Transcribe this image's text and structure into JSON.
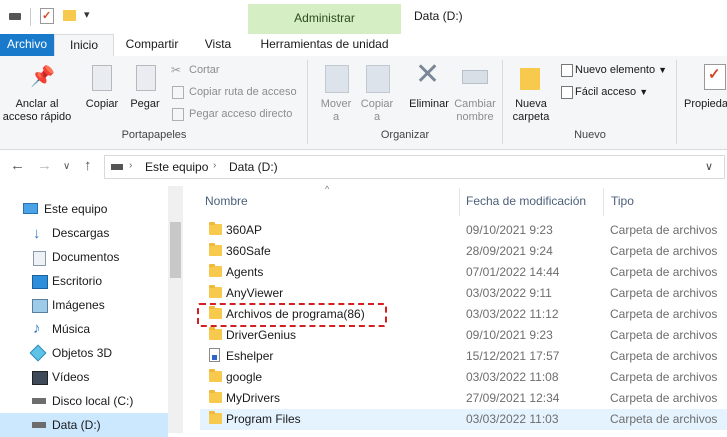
{
  "window": {
    "title": "Data (D:)",
    "contextual_tab": "Administrar"
  },
  "tabs": [
    {
      "label": "Archivo"
    },
    {
      "label": "Inicio"
    },
    {
      "label": "Compartir"
    },
    {
      "label": "Vista"
    },
    {
      "label": "Herramientas de unidad"
    }
  ],
  "ribbon": {
    "portapapeles": {
      "label": "Portapapeles",
      "pin": "Anclar al\nacceso rápido",
      "copy": "Copiar",
      "paste": "Pegar",
      "cut": "Cortar",
      "copy_path": "Copiar ruta de acceso",
      "paste_shortcut": "Pegar acceso directo"
    },
    "organizar": {
      "label": "Organizar",
      "move": "Mover\na",
      "copy_to": "Copiar\na",
      "delete": "Eliminar",
      "rename": "Cambiar\nnombre"
    },
    "nuevo": {
      "label": "Nuevo",
      "new_folder": "Nueva\ncarpeta",
      "new_item": "Nuevo elemento",
      "easy_access": "Fácil acceso"
    },
    "abrir": {
      "properties": "Propieda"
    }
  },
  "address": {
    "segments": [
      "Este equipo",
      "Data (D:)"
    ]
  },
  "sidebar": {
    "items": [
      {
        "label": "Este equipo",
        "icon": "computer-icon"
      },
      {
        "label": "Descargas",
        "icon": "download-icon"
      },
      {
        "label": "Documentos",
        "icon": "documents-icon"
      },
      {
        "label": "Escritorio",
        "icon": "desktop-icon"
      },
      {
        "label": "Imágenes",
        "icon": "pictures-icon"
      },
      {
        "label": "Música",
        "icon": "music-icon"
      },
      {
        "label": "Objetos 3D",
        "icon": "3d-objects-icon"
      },
      {
        "label": "Vídeos",
        "icon": "videos-icon"
      },
      {
        "label": "Disco local (C:)",
        "icon": "drive-icon"
      },
      {
        "label": "Data (D:)",
        "icon": "drive-icon"
      }
    ]
  },
  "files": {
    "columns": [
      "Nombre",
      "Fecha de modificación",
      "Tipo"
    ],
    "rows": [
      {
        "name": "360AP",
        "date": "09/10/2021 9:23",
        "type": "Carpeta de archivos",
        "icon": "folder-icon"
      },
      {
        "name": "360Safe",
        "date": "28/09/2021 9:24",
        "type": "Carpeta de archivos",
        "icon": "folder-icon"
      },
      {
        "name": "Agents",
        "date": "07/01/2022 14:44",
        "type": "Carpeta de archivos",
        "icon": "folder-icon"
      },
      {
        "name": "AnyViewer",
        "date": "03/03/2022 9:11",
        "type": "Carpeta de archivos",
        "icon": "folder-icon"
      },
      {
        "name": "Archivos de programa(86)",
        "date": "03/03/2022 11:12",
        "type": "Carpeta de archivos",
        "icon": "folder-icon"
      },
      {
        "name": "DriverGenius",
        "date": "09/10/2021 9:23",
        "type": "Carpeta de archivos",
        "icon": "folder-icon"
      },
      {
        "name": "Eshelper",
        "date": "15/12/2021 17:57",
        "type": "Carpeta de archivos",
        "icon": "shortcut-icon"
      },
      {
        "name": "google",
        "date": "03/03/2022 11:08",
        "type": "Carpeta de archivos",
        "icon": "folder-icon"
      },
      {
        "name": "MyDrivers",
        "date": "27/09/2021 12:34",
        "type": "Carpeta de archivos",
        "icon": "folder-icon"
      },
      {
        "name": "Program Files",
        "date": "03/03/2022 11:03",
        "type": "Carpeta de archivos",
        "icon": "folder-icon"
      }
    ]
  },
  "colors": {
    "file_tab": "#1979ca",
    "context_tab": "#d5eec3",
    "highlight": "#d21f1f",
    "selection": "#cce8ff"
  }
}
